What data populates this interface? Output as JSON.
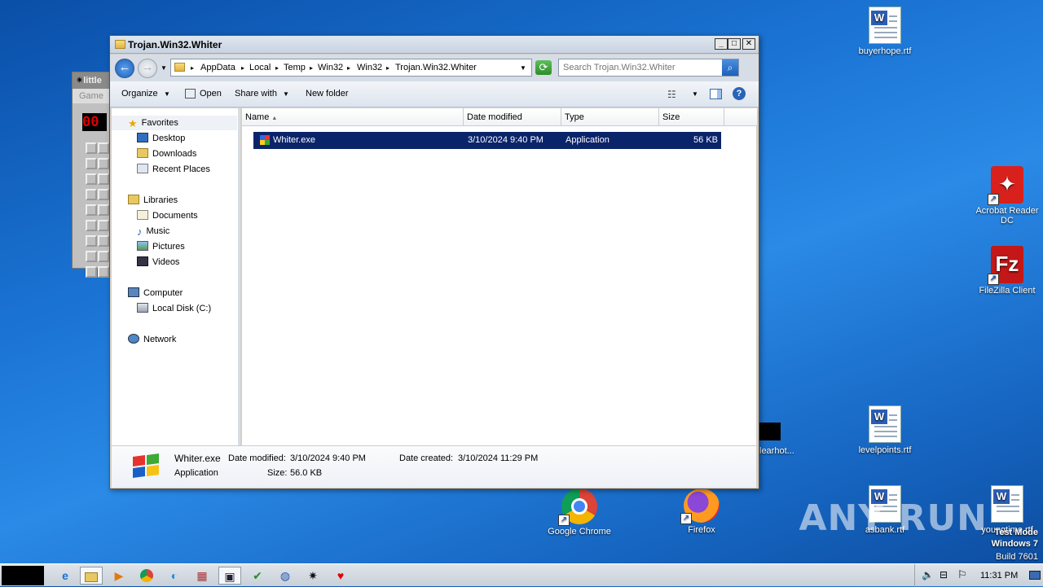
{
  "desktop": {
    "icons": [
      {
        "label": "buyerhope.rtf"
      },
      {
        "label": "Acrobat Reader DC"
      },
      {
        "label": "FileZilla Client"
      },
      {
        "label": "levelpoints.rtf"
      },
      {
        "label": "asbank.rtf"
      },
      {
        "label": "youngtime.rtf"
      },
      {
        "label": "Google Chrome"
      },
      {
        "label": "Firefox"
      },
      {
        "label": "learhot..."
      }
    ],
    "watermark": "ANY RUN",
    "test_mode": {
      "line1": "Test Mode",
      "line2": "Windows 7",
      "line3": "Build 7601"
    }
  },
  "minesweeper": {
    "title": "little",
    "menu": "Game",
    "counter": "00"
  },
  "explorer": {
    "title": "Trojan.Win32.Whiter",
    "controls": {
      "minimize": "_",
      "maximize": "□",
      "close": "✕"
    },
    "breadcrumb": [
      "AppData",
      "Local",
      "Temp",
      "Win32",
      "Win32",
      "Trojan.Win32.Whiter"
    ],
    "search_placeholder": "Search Trojan.Win32.Whiter",
    "toolbar": {
      "organize": "Organize",
      "open": "Open",
      "share_with": "Share with",
      "new_folder": "New folder"
    },
    "nav": {
      "favorites": "Favorites",
      "favorites_items": [
        "Desktop",
        "Downloads",
        "Recent Places"
      ],
      "libraries": "Libraries",
      "libraries_items": [
        "Documents",
        "Music",
        "Pictures",
        "Videos"
      ],
      "computer": "Computer",
      "computer_items": [
        "Local Disk (C:)"
      ],
      "network": "Network"
    },
    "columns": {
      "name": "Name",
      "date_modified": "Date modified",
      "type": "Type",
      "size": "Size"
    },
    "files": [
      {
        "name": "Whiter.exe",
        "date_modified": "3/10/2024 9:40 PM",
        "type": "Application",
        "size": "56 KB"
      }
    ],
    "details": {
      "name": "Whiter.exe",
      "type": "Application",
      "date_modified_label": "Date modified:",
      "date_modified": "3/10/2024 9:40 PM",
      "date_created_label": "Date created:",
      "date_created": "3/10/2024 11:29 PM",
      "size_label": "Size:",
      "size": "56.0 KB"
    }
  },
  "taskbar": {
    "time": "11:31 PM"
  }
}
